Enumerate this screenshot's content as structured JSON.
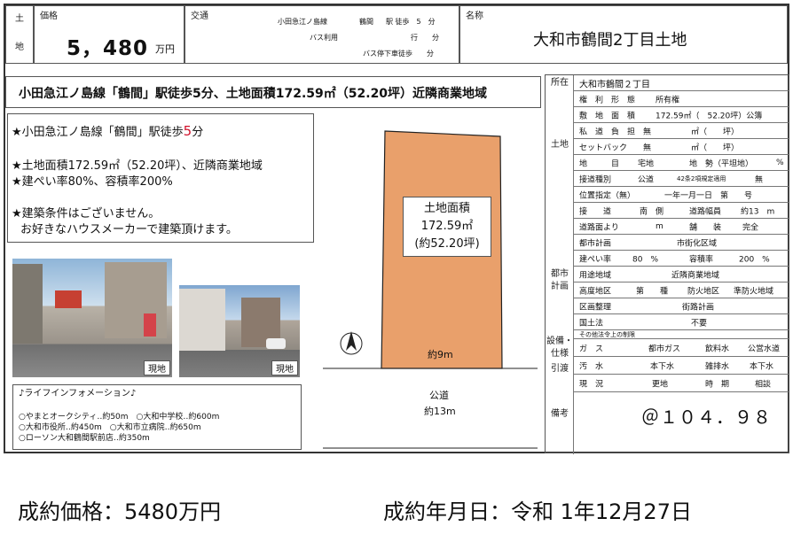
{
  "header": {
    "label_land_top": "土",
    "label_land_bottom": "地",
    "price_label": "価格",
    "price_value": "5，480",
    "price_unit": "万円",
    "traffic_label": "交通",
    "traffic_line": "小田急江ノ島線",
    "traffic_station": "鶴間",
    "traffic_walk": "駅 徒歩　5　分",
    "bus_use": "バス利用",
    "bus_go": "行　　分",
    "bus_stop_walk": "バス停下車徒歩　　分",
    "name_label": "名称",
    "property_name": "大和市鶴間2丁目土地"
  },
  "headline": "小田急江ノ島線「鶴間」駅徒歩5分、土地面積172.59㎡（52.20坪）近隣商業地域",
  "features": {
    "line1_prefix": "★小田急江ノ島線「鶴間」駅徒歩",
    "line1_number": "5",
    "line1_suffix": "分",
    "line2": "★土地面積172.59㎡（52.20坪）、近隣商業地域",
    "line3": "★建ぺい率80%、容積率200%",
    "line4": "★建築条件はございません。",
    "line5": "お好きなハウスメーカーで建築頂けます。"
  },
  "photos": [
    {
      "caption": "現地"
    },
    {
      "caption": "現地"
    }
  ],
  "life_info": {
    "title": "♪ライフインフォメーション♪",
    "line1": "○やまとオークシティ‥約50m　○大和中学校‥約600m",
    "line2": "○大和市役所‥約450m　○大和市立病院‥約650m",
    "line3": "○ローソン大和鶴間駅前店‥約350m"
  },
  "plot": {
    "area_title": "土地面積",
    "area_value": "172.59㎡",
    "area_tsubo": "(約52.20坪)",
    "frontage": "約9m",
    "road_label": "公道",
    "road_width": "約13m"
  },
  "spec": {
    "location_label": "所在",
    "location_value": "大和市鶴間２丁目",
    "land_section": "土地",
    "rights_label": "権　利　形　態",
    "rights_value": "所有権",
    "area_label": "敷　地　面　積",
    "area_value": "172.59㎡（　52.20坪）公簿",
    "private_road_label": "私　道　負　担",
    "private_road_value": "無　　　　　㎡（　　坪）",
    "setback_label": "セットバック",
    "setback_value": "無　　　　　㎡（　　坪）",
    "category_label": "地　　　目",
    "category_value": "宅地",
    "terrain_label": "地　勢（平坦地）",
    "terrain_value": "%",
    "road_type_label": "接道種別",
    "road_type_value": "公道",
    "art42_label": "42条2項規定適用",
    "art42_value": "無",
    "position_label": "位置指定（無）",
    "position_value": "一年一月一日　第　　号",
    "frontage_label": "接　　道",
    "frontage_dir": "南　側",
    "road_width_label": "道路幅員",
    "road_width_value": "約13　m",
    "road_from_label": "道路面より",
    "road_from_value": "m",
    "paved_label": "舗　　装",
    "paved_value": "完全",
    "city_section": "都市計画",
    "cityplan_label": "都市計画",
    "cityplan_value": "市街化区域",
    "coverage_label": "建ぺい率",
    "coverage_value": "80　%",
    "far_label": "容積率",
    "far_value": "200　%",
    "zone_label": "用途地域",
    "zone_value": "近隣商業地域",
    "height_label": "高度地区",
    "height_value": "第　　種",
    "fire_label": "防火地区",
    "fire_value": "準防火地域",
    "readjust_label": "区画整理",
    "readjust_value": "街路計画",
    "national_label": "国土法",
    "national_value": "不要",
    "other_label": "その他法令上の制限",
    "facility_section_1": "設備・",
    "facility_section_2": "仕様",
    "gas_label": "ガ　ス",
    "gas_value": "都市ガス",
    "water_label": "飲料水",
    "water_value": "公営水道",
    "sewage_label": "汚　水",
    "sewage_value": "本下水",
    "drain_label": "雑排水",
    "drain_value": "本下水",
    "delivery_section": "引渡",
    "status_label": "現　況",
    "status_value": "更地",
    "timing_label": "時　期",
    "timing_value": "相談",
    "remarks_label": "備考",
    "remarks_value": "＠１０４．９８"
  },
  "footer": {
    "contract_price": "成約価格：5480万円",
    "contract_date": "成約年月日：令和 1年12月27日"
  }
}
